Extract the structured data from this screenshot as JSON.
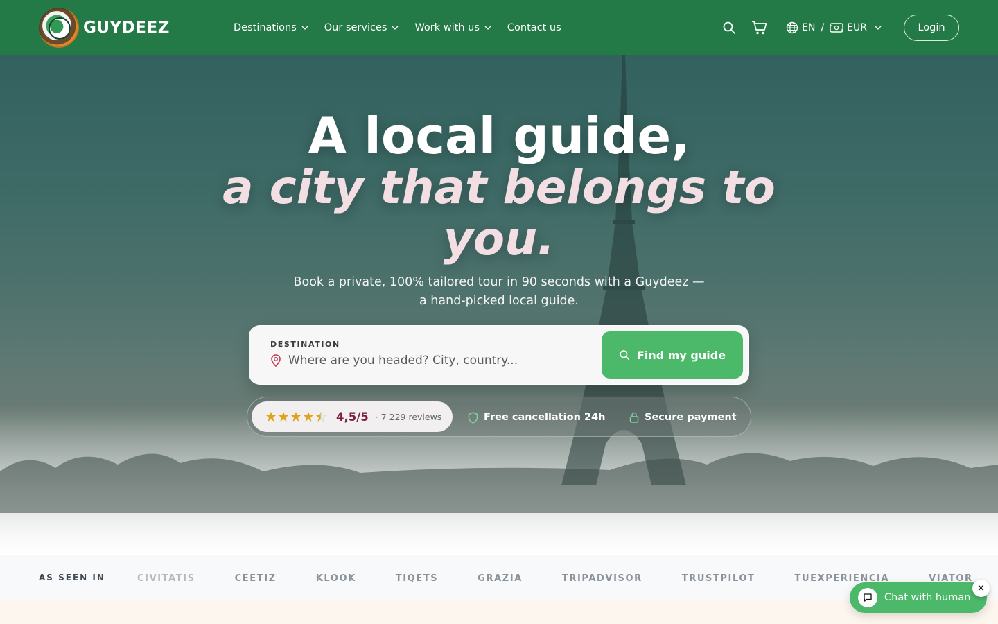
{
  "brand": {
    "name": "GUYDEEZ",
    "logo_icon": "globe-logo-icon",
    "accent": "#237a46",
    "cta": "#4bb86a"
  },
  "nav": {
    "items": [
      {
        "label": "Destinations",
        "has_dropdown": true
      },
      {
        "label": "Our services",
        "has_dropdown": true
      },
      {
        "label": "Work with us",
        "has_dropdown": true
      },
      {
        "label": "Contact us",
        "has_dropdown": false
      }
    ],
    "language": "EN",
    "separator": "/",
    "currency": "EUR",
    "login_label": "Login",
    "search_icon": "search-icon",
    "cart_icon": "cart-icon"
  },
  "hero": {
    "title_line1": "A local guide,",
    "title_line2": "a city that belongs to you.",
    "subtitle_line1": "Book a private, 100% tailored tour in 90 seconds with a Guydeez —",
    "subtitle_line2": "a hand-picked local guide.",
    "search": {
      "label": "DESTINATION",
      "placeholder": "Where are you headed? City, country...",
      "button_label": "Find my guide"
    },
    "trust": {
      "rating": "4,5/5",
      "rating_stars": 4.5,
      "reviews": "· 7 229 reviews",
      "cancellation": "Free cancellation 24h",
      "secure_payment": "Secure payment"
    }
  },
  "press": {
    "label": "AS SEEN IN",
    "items": [
      "CIVITATIS",
      "CEETIZ",
      "KLOOK",
      "TIQETS",
      "GRAZIA",
      "TRIPADVISOR",
      "TRUSTPILOT",
      "TUEXPERIENCIA",
      "VIATOR"
    ]
  },
  "chat": {
    "label": "Chat with human",
    "close": "×"
  }
}
